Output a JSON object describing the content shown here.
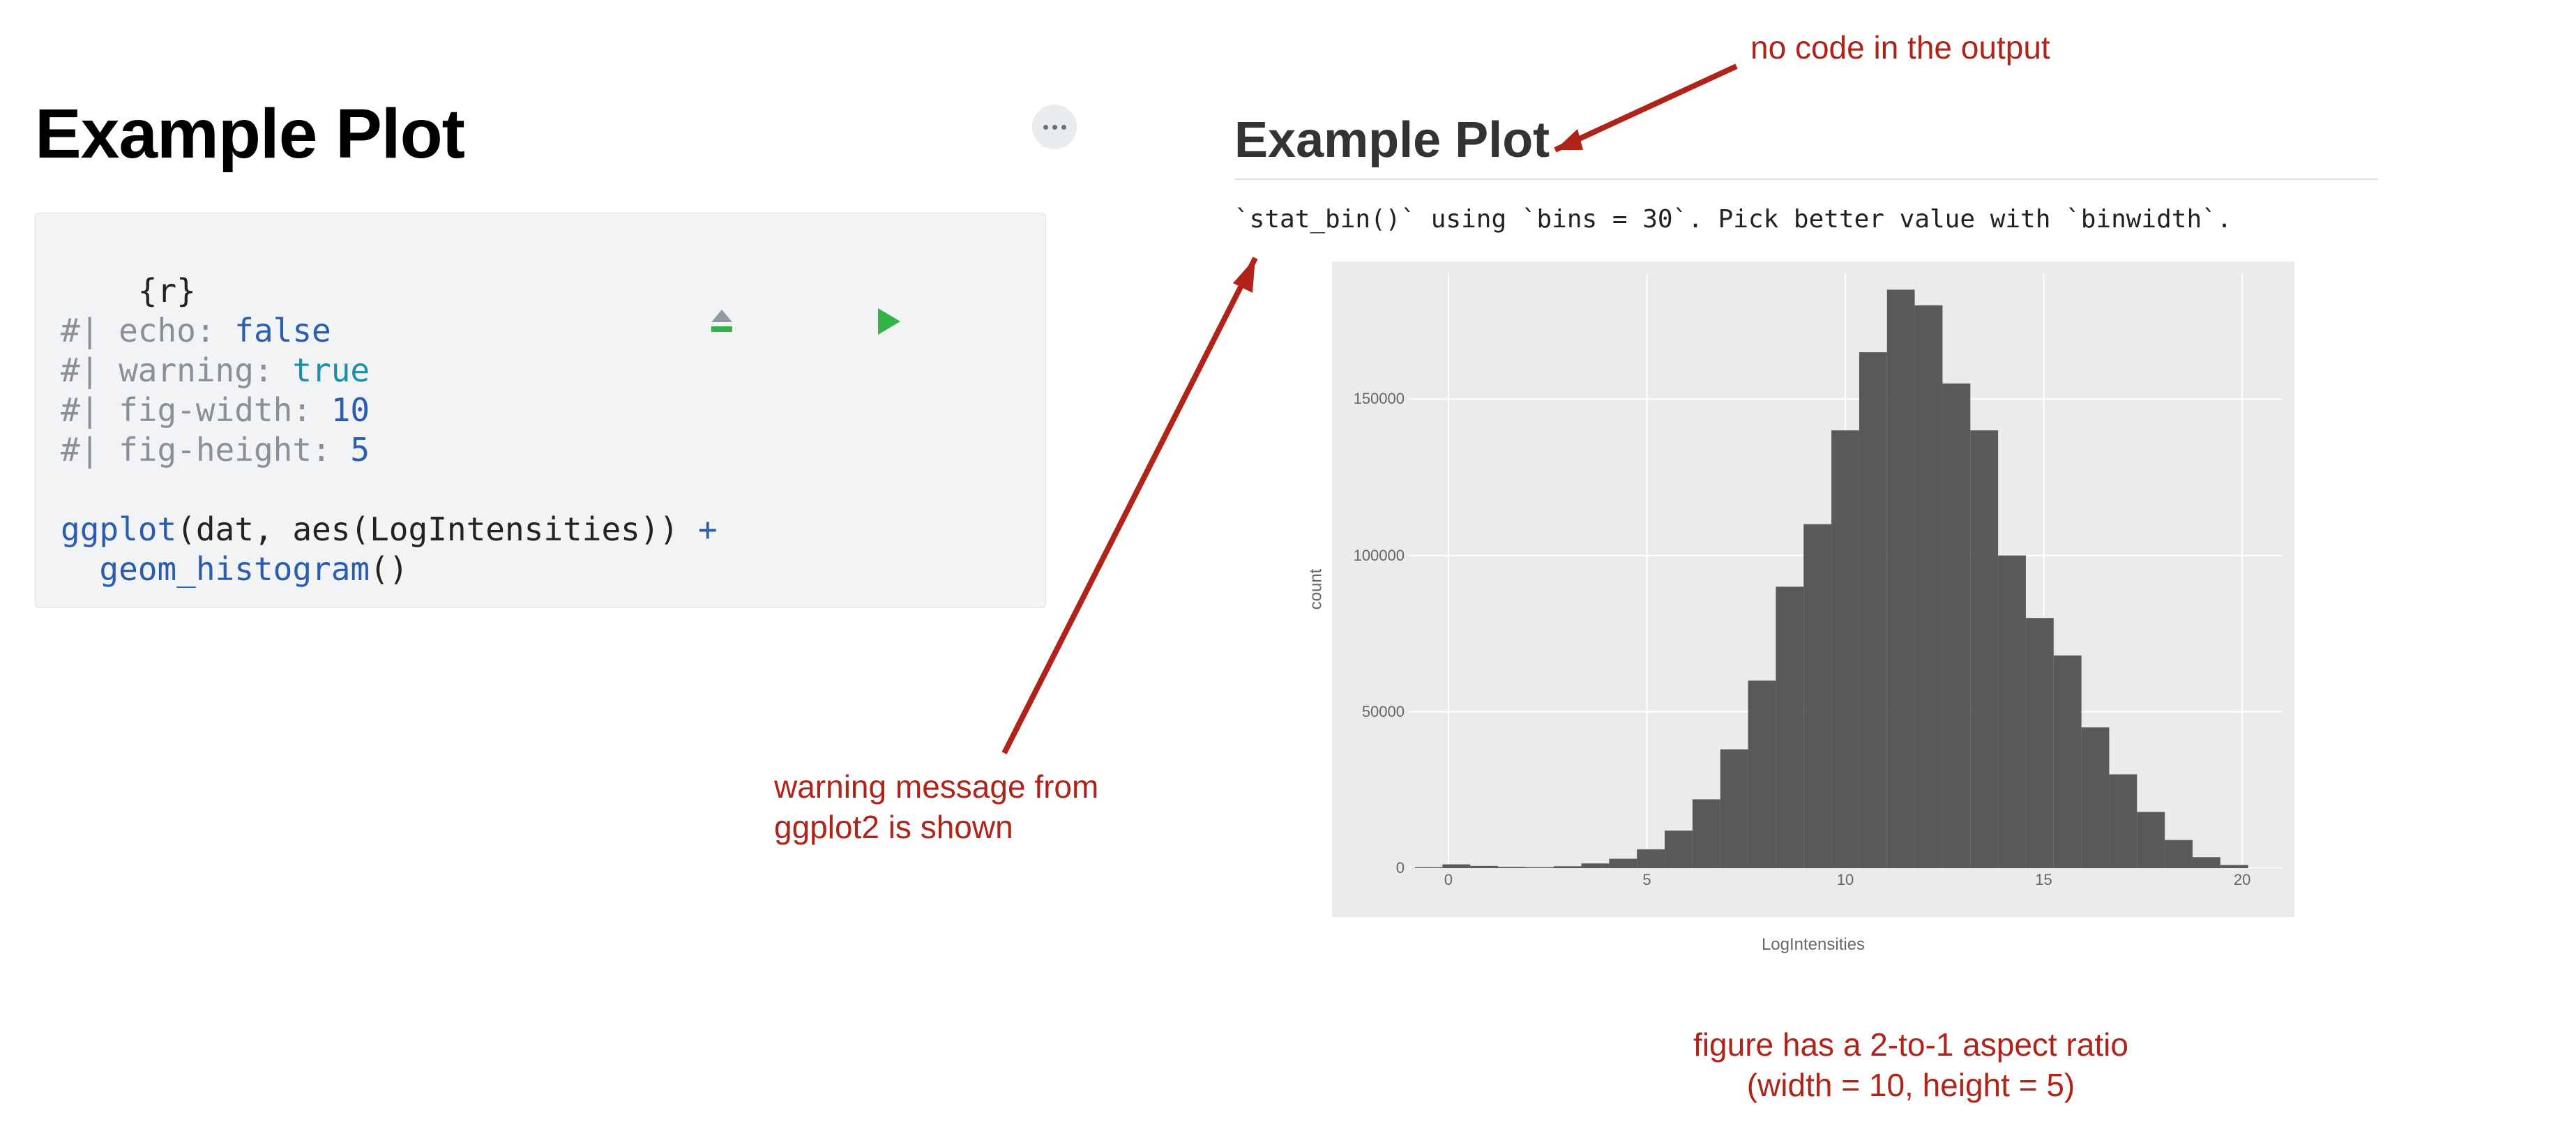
{
  "left": {
    "title": "Example Plot",
    "code": {
      "header": "{r}",
      "opt_echo_key": "#| echo: ",
      "opt_echo_val": "false",
      "opt_warning_key": "#| warning: ",
      "opt_warning_val": "true",
      "opt_figwidth_key": "#| fig-width: ",
      "opt_figwidth_val": "10",
      "opt_figheight_key": "#| fig-height: ",
      "opt_figheight_val": "5",
      "body_line1_a": "ggplot",
      "body_line1_b": "(dat, aes(LogIntensities)) ",
      "body_line1_c": "+",
      "body_line2_a": "  geom_histogram",
      "body_line2_b": "()"
    },
    "toolbar": {
      "run_above_label": "Run all chunks above",
      "run_current_label": "Run current chunk"
    }
  },
  "right": {
    "title": "Example Plot",
    "warning": "`stat_bin()` using `bins = 30`. Pick better value with `binwidth`."
  },
  "annotations": {
    "no_code": "no code in the output",
    "warning_shown_l1": "warning message from",
    "warning_shown_l2": "ggplot2 is shown",
    "aspect_main": "figure has a 2-to-1 aspect ratio",
    "aspect_sub": "(width = 10, height = 5)"
  },
  "chart_data": {
    "type": "bar",
    "xlabel": "LogIntensities",
    "ylabel": "count",
    "xlim": [
      -1,
      21
    ],
    "ylim": [
      0,
      190000
    ],
    "xticks": [
      0,
      5,
      10,
      15,
      20
    ],
    "yticks": [
      0,
      50000,
      100000,
      150000
    ],
    "bin_width": 0.7,
    "categories": [
      -0.5,
      0.2,
      0.9,
      1.6,
      2.3,
      3.0,
      3.7,
      4.4,
      5.1,
      5.8,
      6.5,
      7.2,
      7.9,
      8.6,
      9.3,
      10.0,
      10.7,
      11.4,
      12.1,
      12.8,
      13.5,
      14.2,
      14.9,
      15.6,
      16.3,
      17.0,
      17.7,
      18.4,
      19.1,
      19.8
    ],
    "values": [
      300,
      1200,
      700,
      400,
      300,
      600,
      1500,
      3000,
      6000,
      12000,
      22000,
      38000,
      60000,
      90000,
      110000,
      140000,
      165000,
      185000,
      180000,
      155000,
      140000,
      100000,
      80000,
      68000,
      45000,
      30000,
      18000,
      9000,
      3500,
      1000
    ]
  }
}
